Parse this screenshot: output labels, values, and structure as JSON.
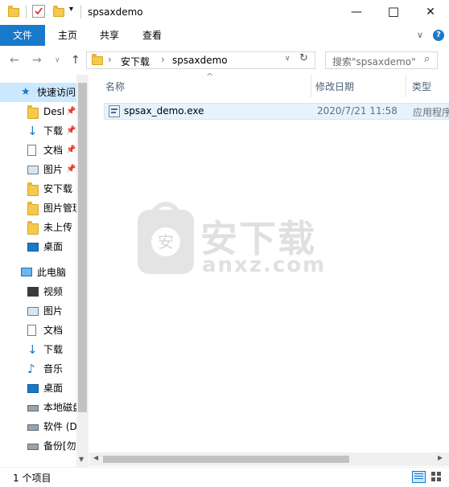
{
  "window": {
    "title": "spsaxdemo",
    "minimize_glyph": "—",
    "maximize_glyph": "☐",
    "close_glyph": "✕"
  },
  "ribbon": {
    "tabs": [
      "文件",
      "主页",
      "共享",
      "查看"
    ],
    "collapse_glyph": "∨",
    "help_glyph": "?"
  },
  "address": {
    "crumbs": [
      "安下载",
      "spsaxdemo"
    ],
    "separator": "›",
    "dropdown_glyph": "∨",
    "refresh_glyph": "↻",
    "search_placeholder": "搜索\"spsaxdemo\"",
    "search_glyph": "⌕"
  },
  "nav": {
    "quick_access": "快速访问",
    "quick_items": [
      "Desl",
      "下载",
      "文档",
      "图片",
      "安下载",
      "图片管理",
      "未上传",
      "桌面"
    ],
    "this_pc": "此电脑",
    "pc_items": [
      "视频",
      "图片",
      "文档",
      "下载",
      "音乐",
      "桌面",
      "本地磁盘",
      "软件 (D",
      "备份[勿"
    ]
  },
  "columns": {
    "name": "名称",
    "modified": "修改日期",
    "type": "类型",
    "sort_glyph": "^"
  },
  "files": [
    {
      "name": "spsax_demo.exe",
      "modified": "2020/7/21 11:58",
      "type": "应用程序"
    }
  ],
  "status": {
    "count": "1 个项目"
  },
  "watermark": {
    "cn": "安下载",
    "en": "anxz.com",
    "badge": "安"
  },
  "colors": {
    "accent": "#1979ca",
    "selection": "#cce8ff",
    "folder": "#f5c94c"
  }
}
